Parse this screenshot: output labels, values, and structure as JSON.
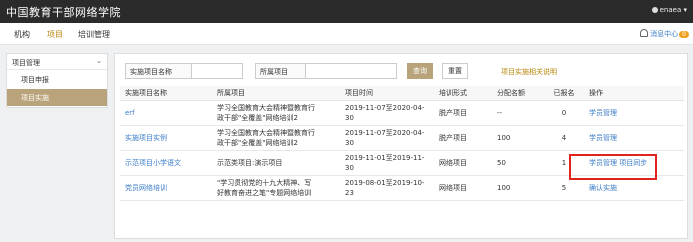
{
  "header": {
    "brand": "中国教育干部网络学院",
    "user": "enaea"
  },
  "nav": {
    "items": [
      {
        "label": "机构"
      },
      {
        "label": "项目"
      },
      {
        "label": "培训管理"
      }
    ],
    "active_index": 1,
    "messages": {
      "label": "消息中心",
      "count": "0"
    }
  },
  "sidebar": {
    "group": "项目管理",
    "items": [
      {
        "label": "项目申报"
      },
      {
        "label": "项目实施"
      }
    ],
    "active_index": 1
  },
  "search": {
    "name_label": "实施项目名称",
    "name_value": "",
    "project_label": "所属项目",
    "project_value": "",
    "query_label": "查询",
    "reset_label": "重置",
    "help_label": "项目实施相关说明"
  },
  "table": {
    "headers": [
      "实施项目名称",
      "所属项目",
      "项目时间",
      "培训形式",
      "分配名额",
      "已报名",
      "操作"
    ],
    "rows": [
      {
        "name": "erf",
        "project_line1": "学习全国教育大会精神暨教育行",
        "project_line2": "政干部\"全覆盖\"网络培训2",
        "time": "2019-11-07至2020-04-30",
        "form": "脱产项目",
        "quota": "--",
        "enrolled": "0",
        "actions": [
          "学员管理"
        ]
      },
      {
        "name": "实施项目实例",
        "project_line1": "学习全国教育大会精神暨教育行",
        "project_line2": "政干部\"全覆盖\"网络培训2",
        "time": "2019-11-07至2020-04-30",
        "form": "脱产项目",
        "quota": "100",
        "enrolled": "4",
        "actions": [
          "学员管理"
        ]
      },
      {
        "name": "示范项目小学语文",
        "project_line1": "示范类项目:演示项目",
        "project_line2": "",
        "time": "2019-11-01至2019-11-30",
        "form": "网络项目",
        "quota": "50",
        "enrolled": "1",
        "actions": [
          "学员管理",
          "项目同步"
        ]
      },
      {
        "name": "党员网络培训",
        "project_line1": "\"学习贯彻党的十九大精神、写",
        "project_line2": "好教育奋进之笔\"专题网络培训",
        "time": "2019-08-01至2019-10-23",
        "form": "网络项目",
        "quota": "100",
        "enrolled": "5",
        "actions": [
          "确认实施"
        ]
      }
    ]
  },
  "colors": {
    "accent": "#b8a37a",
    "link": "#3b7cc7",
    "highlight": "#e0241b",
    "topbar": "#2b2b2b"
  }
}
